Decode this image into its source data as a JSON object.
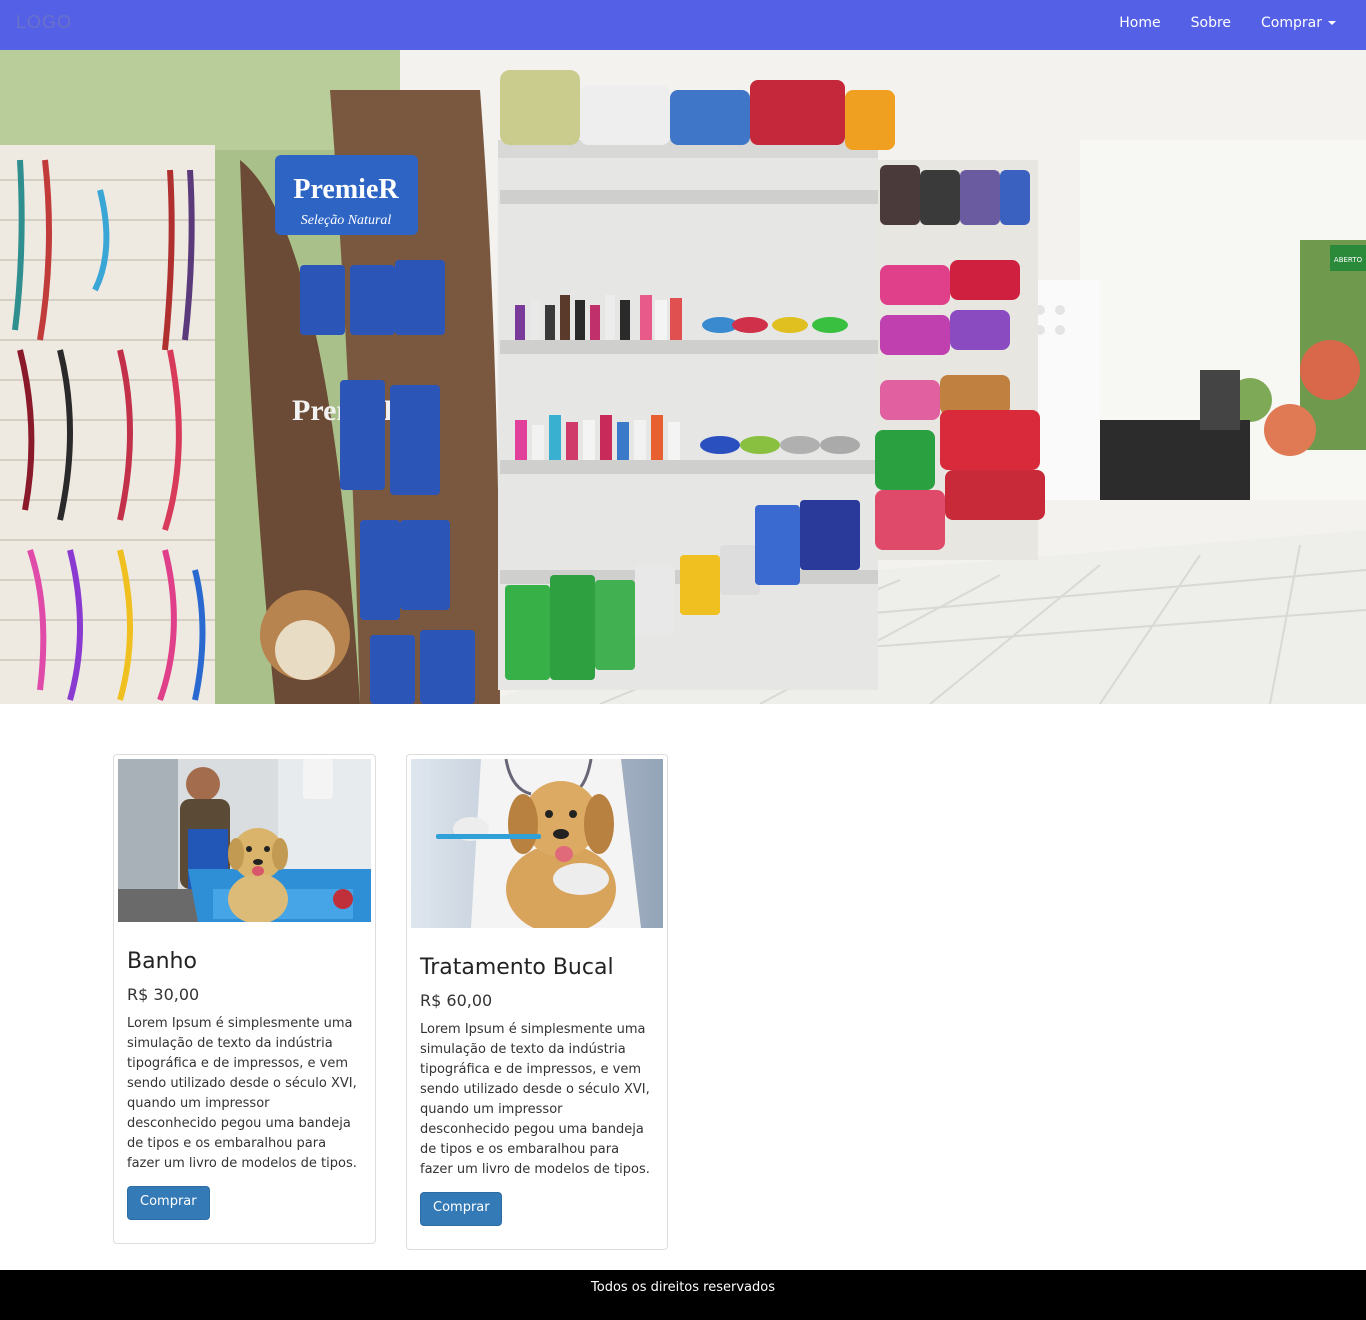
{
  "navbar": {
    "logo": "LOGO",
    "links": {
      "home": "Home",
      "sobre": "Sobre",
      "comprar": "Comprar"
    }
  },
  "hero": {
    "image": "pet-shop-interior",
    "signs": {
      "brand": "PremieR",
      "tagline": "Seleção Natural",
      "open_sign": "ABERTO"
    }
  },
  "products": [
    {
      "title": "Banho",
      "price": "R$ 30,00",
      "description": "Lorem Ipsum é simplesmente uma simulação de texto da indústria tipográfica e de impressos, e vem sendo utilizado desde o século XVI, quando um impressor desconhecido pegou uma bandeja de tipos e os embaralhou para fazer um livro de modelos de tipos.",
      "button": "Comprar",
      "image": "dog-bath-photo"
    },
    {
      "title": "Tratamento Bucal",
      "price": "R$ 60,00",
      "description": "Lorem Ipsum é simplesmente uma simulação de texto da indústria tipográfica e de impressos, e vem sendo utilizado desde o século XVI, quando um impressor desconhecido pegou uma bandeja de tipos e os embaralhou para fazer um livro de modelos de tipos.",
      "button": "Comprar",
      "image": "dog-teeth-brushing-photo"
    }
  ],
  "footer": {
    "text": "Todos os direitos reservados"
  },
  "colors": {
    "navbar": "#5460e6",
    "button": "#337ab7",
    "footer": "#000000"
  }
}
